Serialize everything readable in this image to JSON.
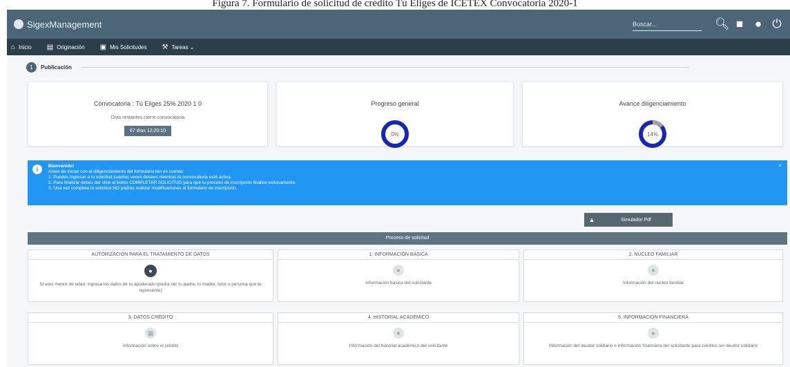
{
  "caption": "Figura 7. Formulario de solicitud de crédito Tú Eliges de ICETEX Convocatoria 2020-1",
  "header": {
    "brand": "SigexManagement",
    "search_placeholder": "Buscar...",
    "icons": [
      "search-icon",
      "chat-icon",
      "user-icon",
      "power-icon"
    ]
  },
  "nav": {
    "items": [
      {
        "label": "Inicio",
        "icon": "home-icon"
      },
      {
        "label": "Originación",
        "icon": "document-icon"
      },
      {
        "label": "Mis Solicitudes",
        "icon": "folder-icon"
      },
      {
        "label": "Tareas ⌄",
        "icon": "wrench-icon"
      }
    ]
  },
  "step": {
    "number": "1",
    "title": "Publicación"
  },
  "cards": {
    "convocatoria": {
      "title": "Convocatoria : Tú Eliges 25% 2020 1 0",
      "subtitle": "Días restantes cierre convocatoria",
      "badge": "67 días 12:20:10"
    },
    "progreso": {
      "title": "Progreso general",
      "value_label": "0%",
      "value": 0
    },
    "avance": {
      "title": "Avance diligenciamiento",
      "value_label": "14%",
      "value": 14
    }
  },
  "alert": {
    "title": "Bienvenido!",
    "lines": [
      "Antes de iniciar con el diligenciamiento del formulario ten en cuenta:",
      "1. Puedes ingresar a tu solicitud cuantas veces desees mientras la convocatoria esté activa.",
      "2. Para finalizar debes dar click al botón COMPLETAR SOLICITUD para que tu proceso de inscripción finalice exitosamente.",
      "3. Una vez completa la solicitud NO podrás realizar modificaciones al formulario de inscripción."
    ],
    "close": "×"
  },
  "pdf_button": "Simulador Pdf",
  "process_title": "Proceso de solicitud",
  "sections": [
    {
      "title": "AUTORIZACIÓN PARA EL TRATAMIENTO DE DATOS",
      "desc": "Si eres menor de edad, ingresa los datos de tu apoderado (podrá ser tu padre, tu madre, tutor o persona que te represente)"
    },
    {
      "title": "1. INFORMACIÓN BÁSICA",
      "desc": "Información básica del solicitante"
    },
    {
      "title": "2. NÚCLEO FAMILIAR",
      "desc": "Información del núcleo familiar"
    },
    {
      "title": "3. DATOS CRÉDITO",
      "desc": "Información sobre el crédito"
    },
    {
      "title": "4. HISTORIAL ACADÉMICO",
      "desc": "Información del historial académico del solicitante"
    },
    {
      "title": "5. INFORMACIÓN FINANCIERA",
      "desc": "Información del deudor solidario o Información financiera del solicitante para créditos sin deudor solidario"
    }
  ],
  "colors": {
    "header": "#4d6677",
    "nav": "#2d3e4b",
    "alert": "#2196f3",
    "ring": "#1428b4",
    "ring_track": "#9aa0a6"
  }
}
